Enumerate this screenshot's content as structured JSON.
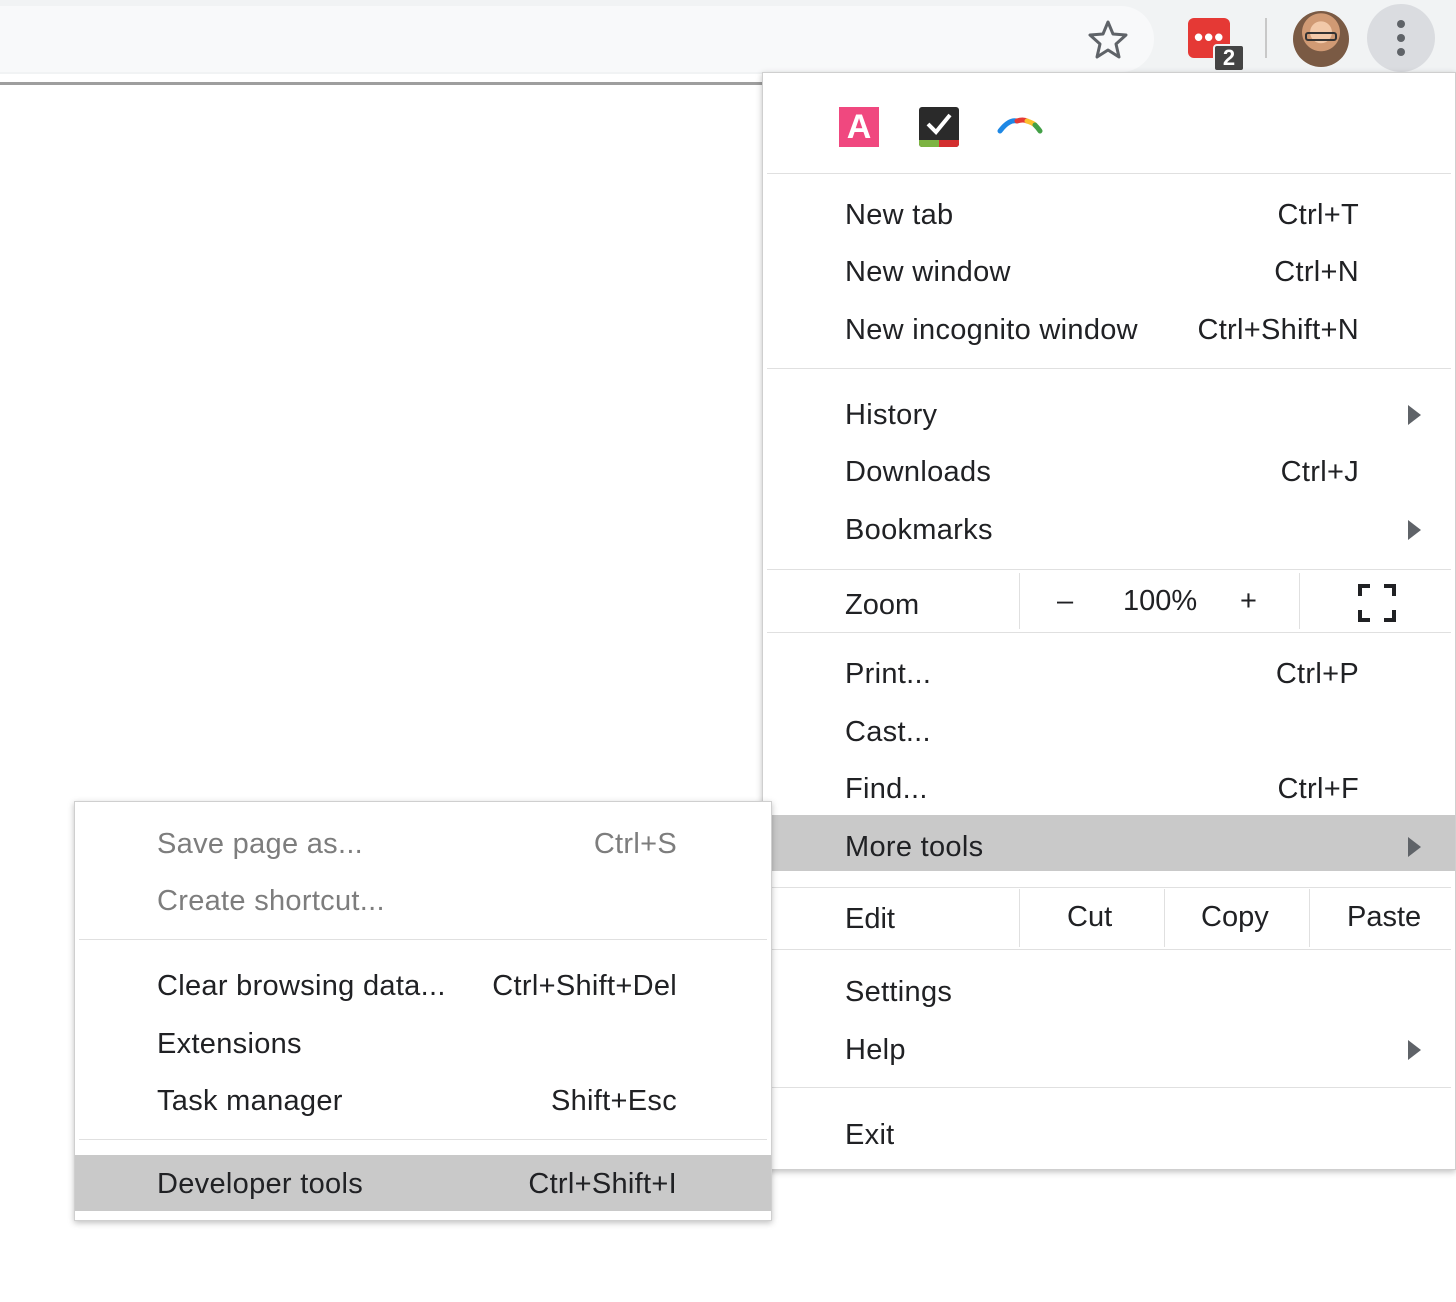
{
  "toolbar": {
    "extension_badge": "2"
  },
  "bookmarks": {
    "items": [
      {
        "icon": "a-letter-icon",
        "label": "A"
      },
      {
        "icon": "checkmark-icon"
      },
      {
        "icon": "rainbow-arc-icon"
      }
    ]
  },
  "menu": {
    "new_tab": {
      "label": "New tab",
      "shortcut": "Ctrl+T"
    },
    "new_window": {
      "label": "New window",
      "shortcut": "Ctrl+N"
    },
    "new_incognito": {
      "label": "New incognito window",
      "shortcut": "Ctrl+Shift+N"
    },
    "history": {
      "label": "History"
    },
    "downloads": {
      "label": "Downloads",
      "shortcut": "Ctrl+J"
    },
    "bookmarks": {
      "label": "Bookmarks"
    },
    "zoom": {
      "label": "Zoom",
      "minus": "–",
      "value": "100%",
      "plus": "+"
    },
    "print": {
      "label": "Print...",
      "shortcut": "Ctrl+P"
    },
    "cast": {
      "label": "Cast..."
    },
    "find": {
      "label": "Find...",
      "shortcut": "Ctrl+F"
    },
    "more_tools": {
      "label": "More tools"
    },
    "edit": {
      "label": "Edit",
      "cut": "Cut",
      "copy": "Copy",
      "paste": "Paste"
    },
    "settings": {
      "label": "Settings"
    },
    "help": {
      "label": "Help"
    },
    "exit": {
      "label": "Exit"
    }
  },
  "submenu": {
    "save_page": {
      "label": "Save page as...",
      "shortcut": "Ctrl+S"
    },
    "create_shortcut": {
      "label": "Create shortcut..."
    },
    "clear_data": {
      "label": "Clear browsing data...",
      "shortcut": "Ctrl+Shift+Del"
    },
    "extensions": {
      "label": "Extensions"
    },
    "task_manager": {
      "label": "Task manager",
      "shortcut": "Shift+Esc"
    },
    "dev_tools": {
      "label": "Developer tools",
      "shortcut": "Ctrl+Shift+I"
    }
  },
  "colors": {
    "highlight": "#c9c9c9",
    "toolbar": "#f1f3f4",
    "extension_red": "#e53935",
    "bookmark_pink": "#f0487f"
  }
}
